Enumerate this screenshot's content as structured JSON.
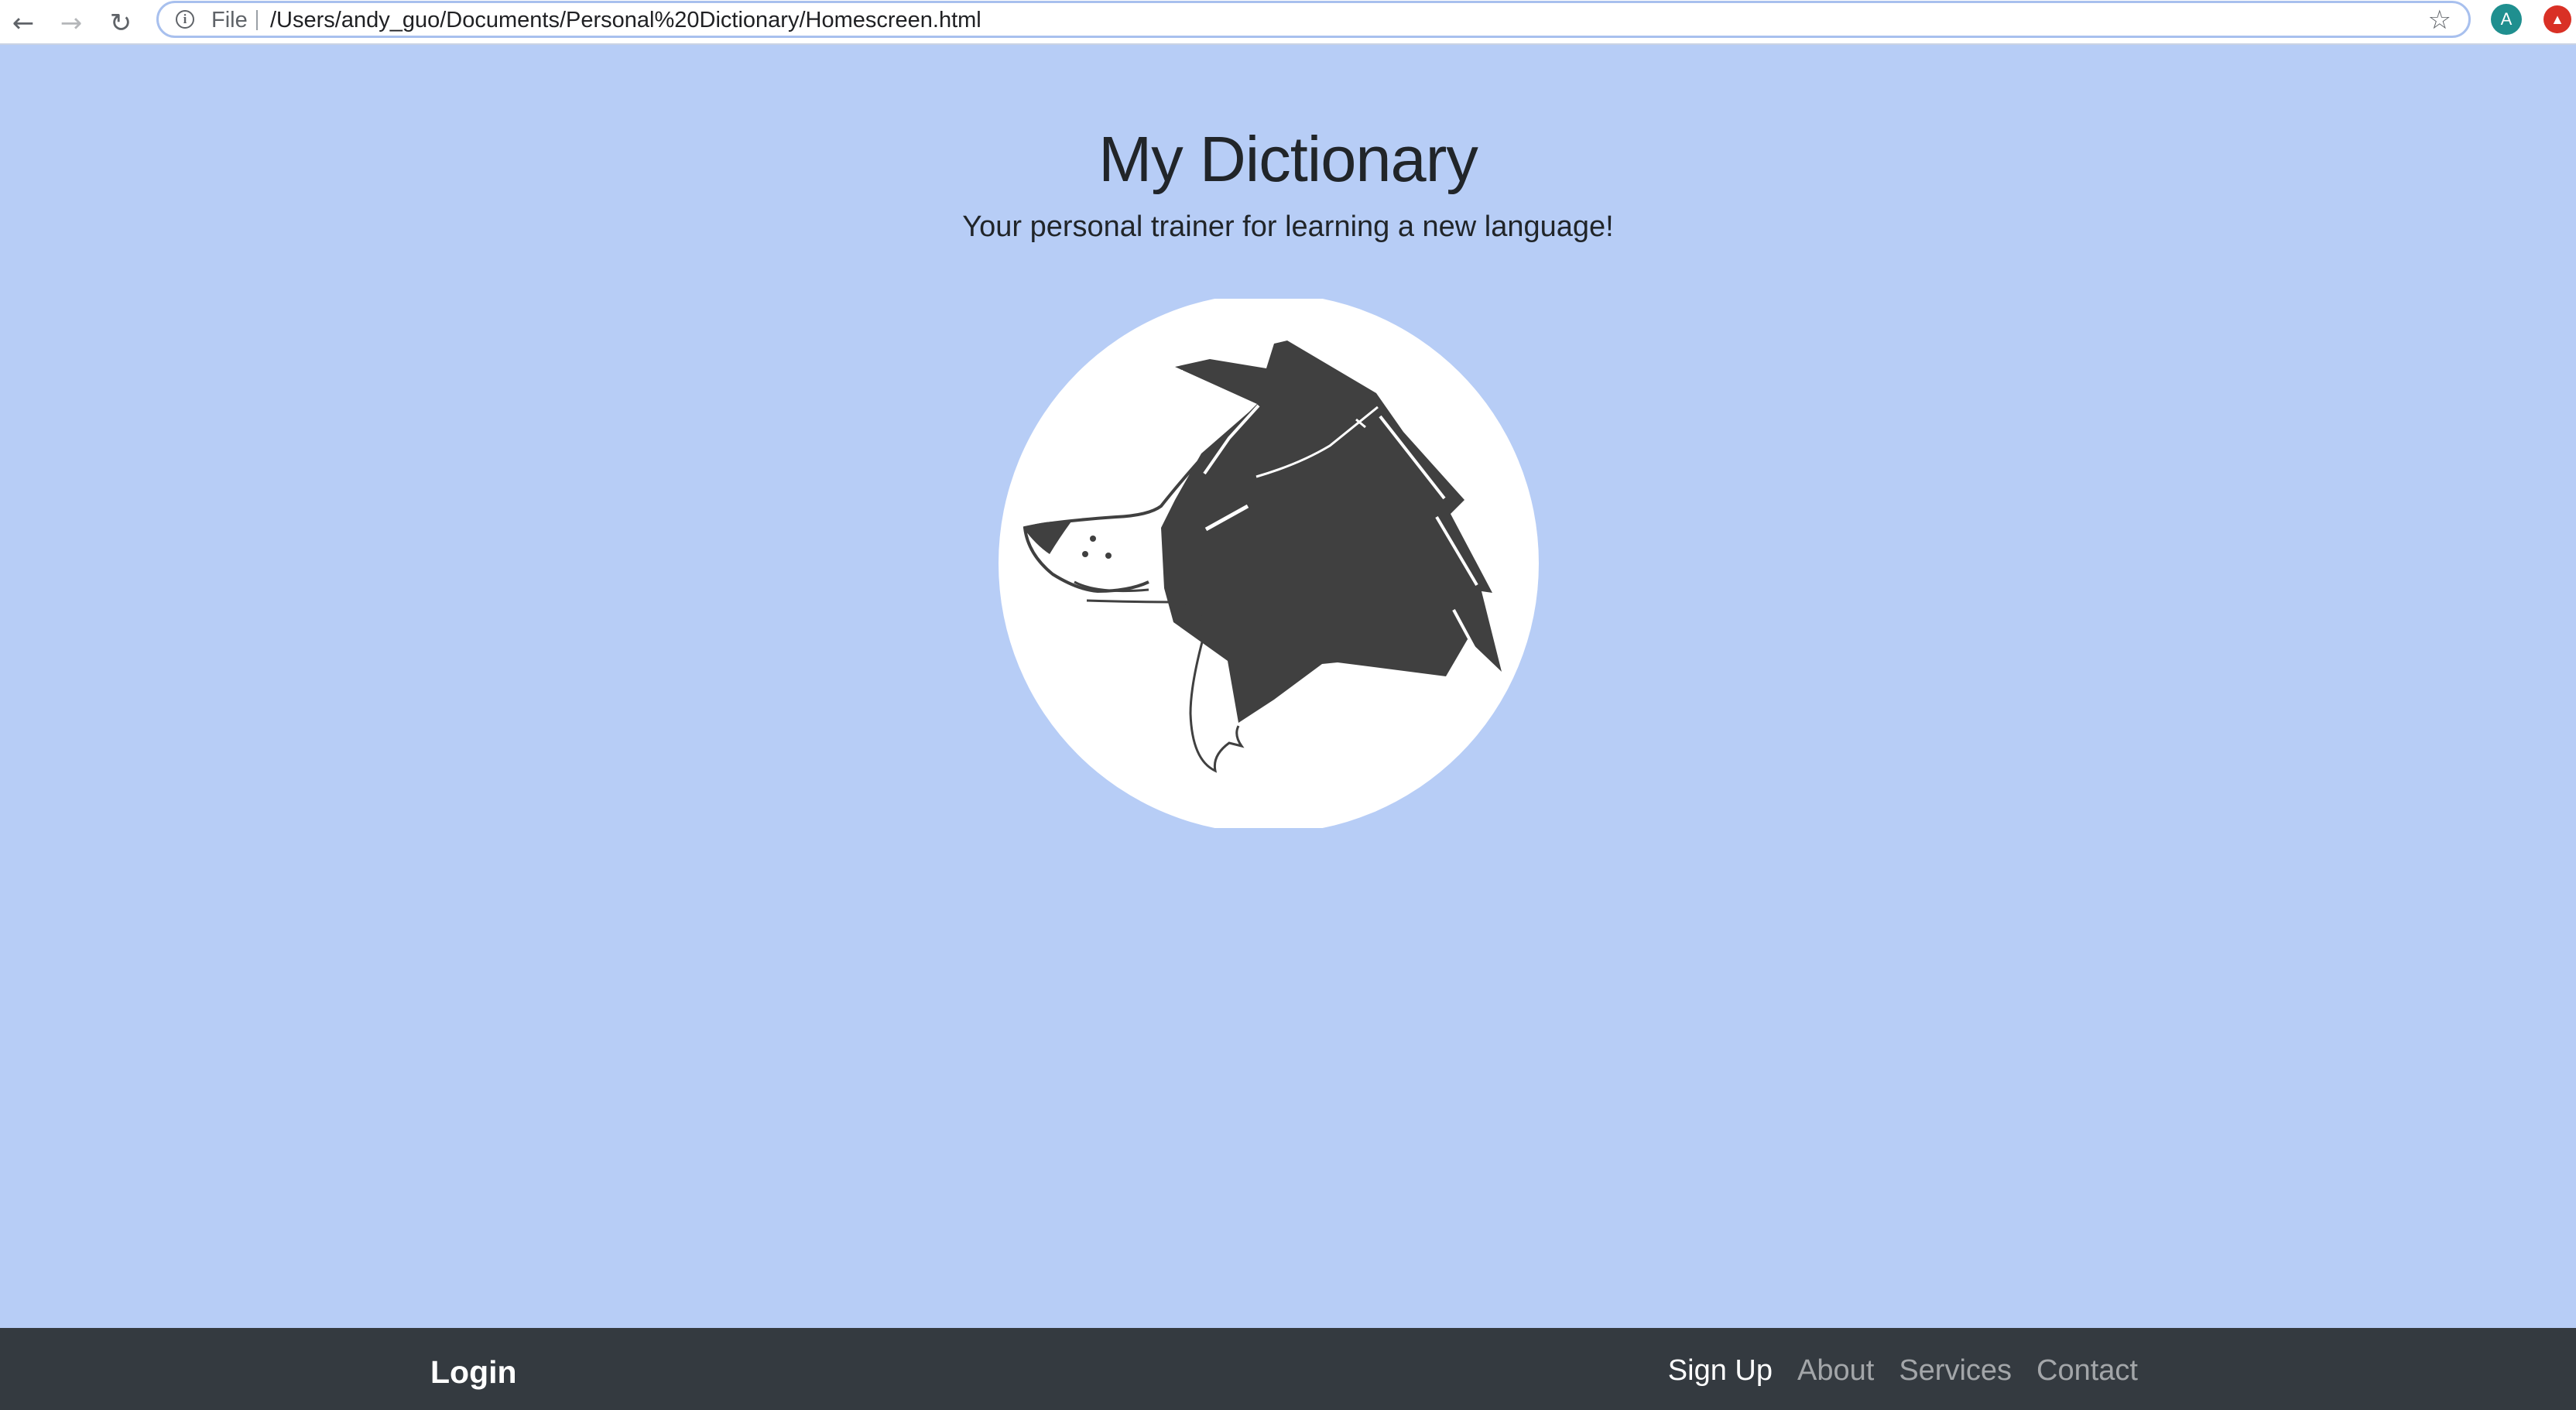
{
  "browser": {
    "back_icon": "arrow-left-icon",
    "forward_icon": "arrow-right-icon",
    "reload_icon": "reload-icon",
    "scheme_label": "File",
    "url": "/Users/andy_guo/Documents/Personal%20Dictionary/Homescreen.html",
    "profile_initial": "A"
  },
  "hero": {
    "title": "My Dictionary",
    "subtitle": "Your personal trainer for learning a new language!",
    "logo_icon": "dog-head-logo"
  },
  "navbar": {
    "brand": "Login",
    "links": [
      {
        "label": "Sign Up",
        "active": true
      },
      {
        "label": "About",
        "active": false
      },
      {
        "label": "Services",
        "active": false
      },
      {
        "label": "Contact",
        "active": false
      }
    ]
  },
  "colors": {
    "page_background": "#b7cdf6",
    "navbar_background": "#343a40",
    "logo_circle": "#ffffff",
    "logo_fill": "#404040"
  }
}
